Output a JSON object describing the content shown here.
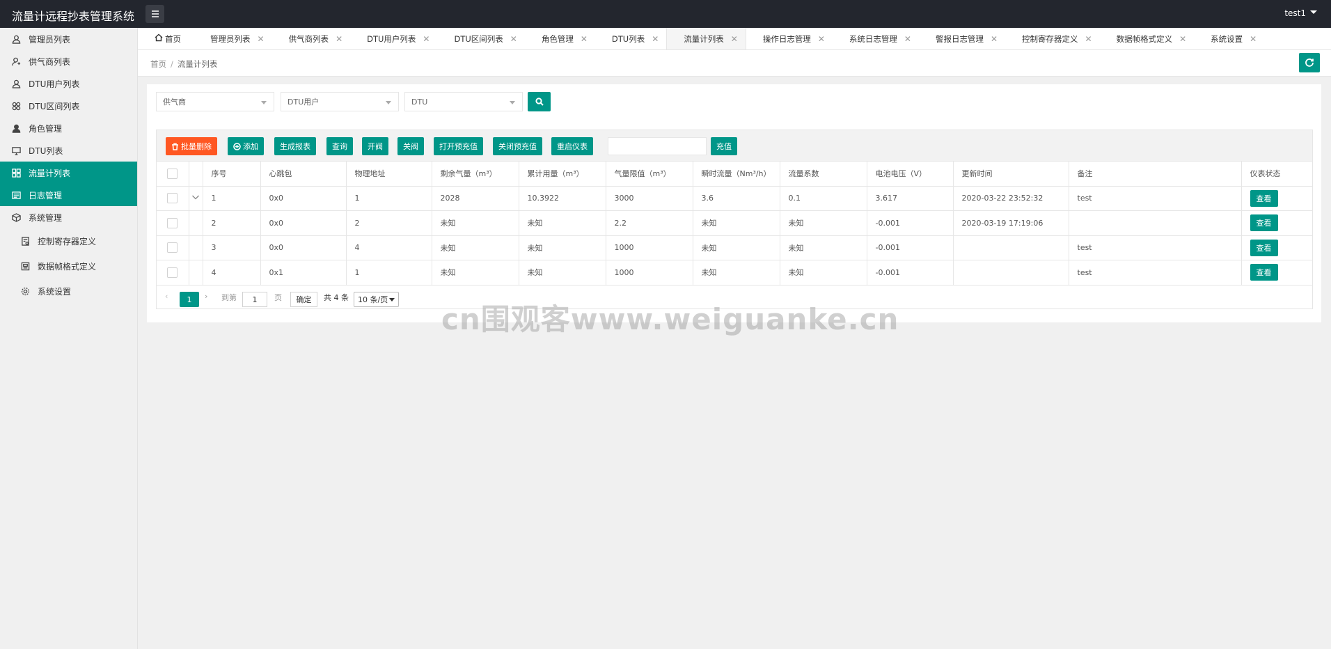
{
  "header": {
    "app_title": "流量计远程抄表管理系统",
    "user": "test1"
  },
  "sidebar": {
    "items": [
      {
        "label": "管理员列表",
        "icon": "user-icon"
      },
      {
        "label": "供气商列表",
        "icon": "user-supplier-icon"
      },
      {
        "label": "DTU用户列表",
        "icon": "user-icon"
      },
      {
        "label": "DTU区间列表",
        "icon": "interval-icon"
      },
      {
        "label": "角色管理",
        "icon": "person-icon"
      },
      {
        "label": "DTU列表",
        "icon": "monitor-icon"
      },
      {
        "label": "流量计列表",
        "icon": "grid-icon"
      },
      {
        "label": "日志管理",
        "icon": "log-icon"
      },
      {
        "label": "系统管理",
        "icon": "box-icon"
      },
      {
        "label": "控制寄存器定义",
        "icon": "register-icon"
      },
      {
        "label": "数据帧格式定义",
        "icon": "frame-icon"
      },
      {
        "label": "系统设置",
        "icon": "gear-icon"
      }
    ]
  },
  "tabs": [
    {
      "label": "首页"
    },
    {
      "label": "管理员列表"
    },
    {
      "label": "供气商列表"
    },
    {
      "label": "DTU用户列表"
    },
    {
      "label": "DTU区间列表"
    },
    {
      "label": "角色管理"
    },
    {
      "label": "DTU列表"
    },
    {
      "label": "流量计列表"
    },
    {
      "label": "操作日志管理"
    },
    {
      "label": "系统日志管理"
    },
    {
      "label": "警报日志管理"
    },
    {
      "label": "控制寄存器定义"
    },
    {
      "label": "数据帧格式定义"
    },
    {
      "label": "系统设置"
    }
  ],
  "breadcrumb": {
    "home": "首页",
    "sep": "/",
    "current": "流量计列表"
  },
  "filters": {
    "supplier": "供气商",
    "dtu_user": "DTU用户",
    "dtu": "DTU"
  },
  "toolbar": {
    "batch_delete": "批量删除",
    "add": "添加",
    "report": "生成报表",
    "query": "查询",
    "open_valve": "开阀",
    "close_valve": "关阀",
    "open_prepay": "打开预充值",
    "close_prepay": "关闭预充值",
    "restart": "重启仪表",
    "recharge": "充值"
  },
  "table": {
    "columns": [
      "序号",
      "心跳包",
      "物理地址",
      "剩余气量（m³）",
      "累计用量（m³）",
      "气量限值（m³）",
      "瞬时流量（Nm³/h）",
      "流量系数",
      "电池电压（V）",
      "更新时间",
      "备注",
      "仪表状态"
    ],
    "rows": [
      [
        "1",
        "0x0",
        "1",
        "2028",
        "10.3922",
        "3000",
        "3.6",
        "0.1",
        "3.617",
        "2020-03-22 23:52:32",
        "test",
        "查看"
      ],
      [
        "2",
        "0x0",
        "2",
        "未知",
        "未知",
        "2.2",
        "未知",
        "未知",
        "-0.001",
        "2020-03-19 17:19:06",
        "",
        "查看"
      ],
      [
        "3",
        "0x0",
        "4",
        "未知",
        "未知",
        "1000",
        "未知",
        "未知",
        "-0.001",
        "",
        "test",
        "查看"
      ],
      [
        "4",
        "0x1",
        "1",
        "未知",
        "未知",
        "1000",
        "未知",
        "未知",
        "-0.001",
        "",
        "test",
        "查看"
      ]
    ]
  },
  "pager": {
    "current": "1",
    "goto": "到第",
    "page_value": "1",
    "page_unit": "页",
    "ok": "确定",
    "total": "共 4 条",
    "size": "10 条/页"
  },
  "watermark": "cn围观客www.weiguanke.cn",
  "colors": {
    "primary": "#009688",
    "danger": "#ff5722",
    "header": "#23262e"
  }
}
